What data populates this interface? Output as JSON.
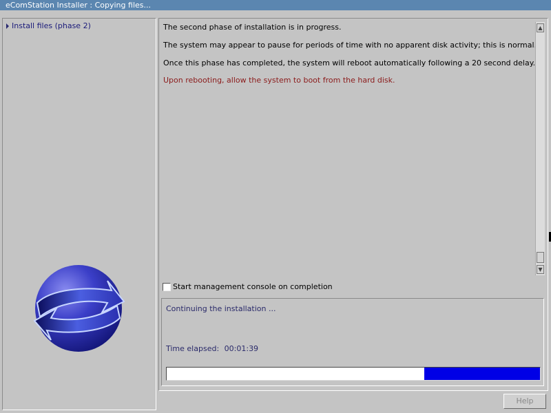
{
  "window": {
    "title": "eComStation Installer : Copying files..."
  },
  "sidebar": {
    "items": [
      {
        "label": "Install files (phase 2)"
      }
    ]
  },
  "main": {
    "messages": [
      "The second phase of installation is in progress.",
      "The system may appear to pause for periods of time with no apparent disk activity; this is normal.",
      "Once this phase has completed, the system will reboot automatically following a 20 second delay."
    ],
    "warning": "Upon rebooting, allow the system to boot from the hard disk.",
    "scroll_up_icon": "arrow-up-icon",
    "scroll_down_icon": "arrow-down-icon"
  },
  "options": {
    "console_checkbox_label": "Start management console on completion",
    "console_checked": false
  },
  "status": {
    "text": "Continuing the installation ...",
    "elapsed_label": "Time elapsed:",
    "elapsed_value": "00:01:39",
    "progress_fraction": 0.31
  },
  "buttons": {
    "help_label": "Help"
  },
  "colors": {
    "titlebar": "#5b86b0",
    "background": "#c4c4c4",
    "progress_fill": "#0000e6",
    "warning_text": "#8b1a1a",
    "status_text": "#2a2a6a"
  }
}
